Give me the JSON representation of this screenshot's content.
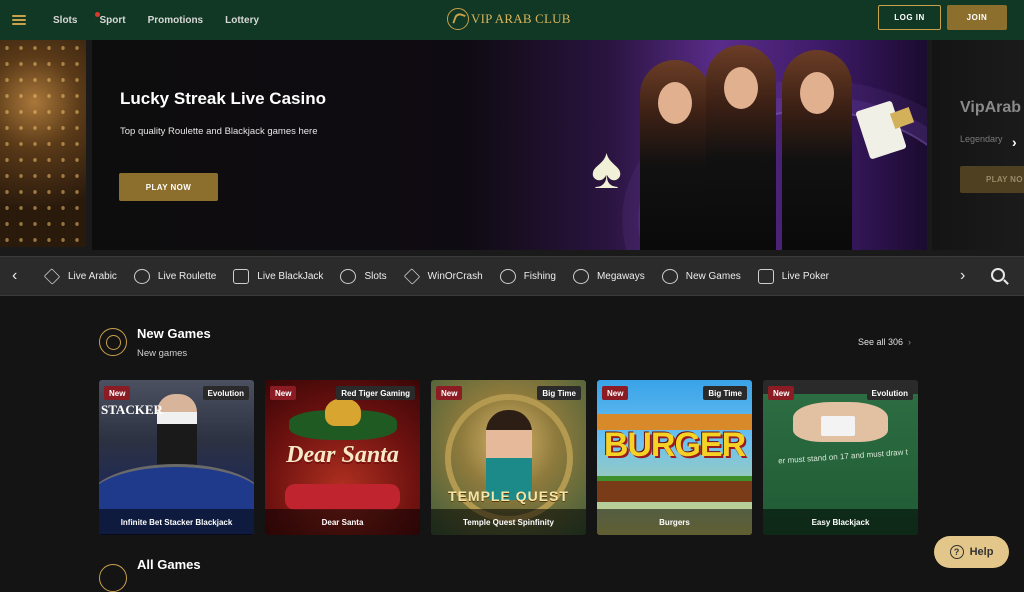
{
  "header": {
    "nav": [
      "Slots",
      "Sport",
      "Promotions",
      "Lottery"
    ],
    "logo": "VIP ARAB CLUB",
    "login_label": "LOG IN",
    "join_label": "JOIN"
  },
  "hero": {
    "title": "Lucky Streak Live Casino",
    "subtitle": "Top quality Roulette and Blackjack games here",
    "play_label": "PLAY NOW",
    "next_title": "VipArab",
    "next_sub": "Legendary",
    "next_btn": "PLAY NO"
  },
  "categories": [
    "Live Arabic",
    "Live Roulette",
    "Live BlackJack",
    "Slots",
    "WinOrCrash",
    "Fishing",
    "Megaways",
    "New Games",
    "Live Poker"
  ],
  "section": {
    "title": "New Games",
    "subtitle": "New games",
    "see_all": "See all 306"
  },
  "games": [
    {
      "name": "Infinite Bet Stacker Blackjack",
      "badge": "New",
      "provider": "Evolution",
      "art_text": "STACKER"
    },
    {
      "name": "Dear Santa",
      "badge": "New",
      "provider": "Red Tiger Gaming",
      "art_text": "Dear Santa"
    },
    {
      "name": "Temple Quest Spinfinity",
      "badge": "New",
      "provider": "Big Time",
      "art_text": "TEMPLE QUEST"
    },
    {
      "name": "Burgers",
      "badge": "New",
      "provider": "Big Time",
      "art_text": "BURGER"
    },
    {
      "name": "Easy Blackjack",
      "badge": "New",
      "provider": "Evolution",
      "art_text": "er must stand on 17 and must draw t"
    }
  ],
  "section2": {
    "title": "All Games"
  },
  "help_label": "Help"
}
